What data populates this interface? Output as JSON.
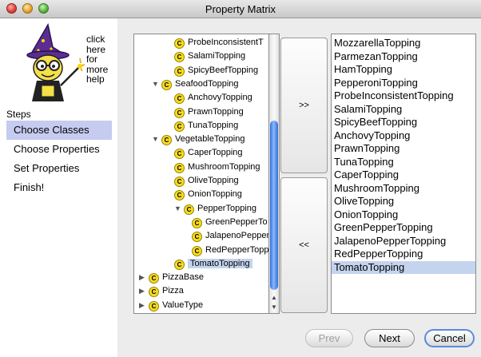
{
  "window": {
    "title": "Property Matrix"
  },
  "help": {
    "lines": [
      "click",
      "here",
      "for",
      "more",
      "help"
    ]
  },
  "steps": {
    "label": "Steps",
    "items": [
      {
        "label": "Choose Classes",
        "selected": true
      },
      {
        "label": "Choose Properties",
        "selected": false
      },
      {
        "label": "Set Properties",
        "selected": false
      },
      {
        "label": "Finish!",
        "selected": false
      }
    ]
  },
  "tree": {
    "icon_glyph": "C",
    "expanded_glyph": "▼",
    "collapsed_glyph": "▶",
    "items": [
      {
        "label": "ProbeInconsistentT",
        "depth": 2,
        "twisty": ""
      },
      {
        "label": "SalamiTopping",
        "depth": 2,
        "twisty": ""
      },
      {
        "label": "SpicyBeefTopping",
        "depth": 2,
        "twisty": ""
      },
      {
        "label": "SeafoodTopping",
        "depth": 1,
        "twisty": "expanded"
      },
      {
        "label": "AnchovyTopping",
        "depth": 2,
        "twisty": ""
      },
      {
        "label": "PrawnTopping",
        "depth": 2,
        "twisty": ""
      },
      {
        "label": "TunaTopping",
        "depth": 2,
        "twisty": ""
      },
      {
        "label": "VegetableTopping",
        "depth": 1,
        "twisty": "expanded"
      },
      {
        "label": "CaperTopping",
        "depth": 2,
        "twisty": ""
      },
      {
        "label": "MushroomTopping",
        "depth": 2,
        "twisty": ""
      },
      {
        "label": "OliveTopping",
        "depth": 2,
        "twisty": ""
      },
      {
        "label": "OnionTopping",
        "depth": 2,
        "twisty": ""
      },
      {
        "label": "PepperTopping",
        "depth": 2,
        "twisty": "expanded"
      },
      {
        "label": "GreenPepperTo",
        "depth": 3,
        "twisty": ""
      },
      {
        "label": "JalapenoPepper",
        "depth": 3,
        "twisty": ""
      },
      {
        "label": "RedPepperTopp",
        "depth": 3,
        "twisty": ""
      },
      {
        "label": "TomatoTopping",
        "depth": 2,
        "twisty": "",
        "selected": true
      },
      {
        "label": "PizzaBase",
        "depth": 0,
        "twisty": "collapsed"
      },
      {
        "label": "Pizza",
        "depth": 0,
        "twisty": "collapsed"
      },
      {
        "label": "ValueType",
        "depth": 0,
        "twisty": "collapsed"
      }
    ]
  },
  "buttons": {
    "add": ">>",
    "remove": "<<",
    "prev": "Prev",
    "next": "Next",
    "cancel": "Cancel"
  },
  "selected_list": {
    "items": [
      "MozzarellaTopping",
      "ParmezanTopping",
      "HamTopping",
      "PepperoniTopping",
      "ProbeInconsistentTopping",
      "SalamiTopping",
      "SpicyBeefTopping",
      "AnchovyTopping",
      "PrawnTopping",
      "TunaTopping",
      "CaperTopping",
      "MushroomTopping",
      "OliveTopping",
      "OnionTopping",
      "GreenPepperTopping",
      "JalapenoPepperTopping",
      "RedPepperTopping",
      "TomatoTopping"
    ],
    "selected": "TomatoTopping"
  },
  "colors": {
    "selection": "#c4d4ee",
    "step_selection": "#c6cbf0",
    "scroll_thumb": "#3a7be0"
  }
}
